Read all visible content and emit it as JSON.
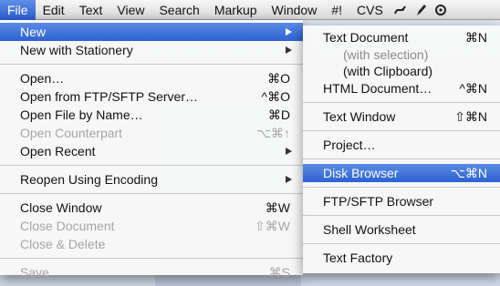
{
  "menubar": {
    "items": [
      "File",
      "Edit",
      "Text",
      "View",
      "Search",
      "Markup",
      "Window",
      "#!",
      "CVS"
    ],
    "icons": [
      "script-icon",
      "pencil-icon",
      "settings-icon"
    ]
  },
  "file_menu": {
    "new": "New",
    "new_stationery": "New with Stationery",
    "open": "Open…",
    "open_sc": "⌘O",
    "open_ftp": "Open from FTP/SFTP Server…",
    "open_ftp_sc": "^⌘O",
    "open_name": "Open File by Name…",
    "open_name_sc": "⌘D",
    "open_counterpart": "Open Counterpart",
    "open_counterpart_sc": "⌥⌘↑",
    "open_recent": "Open Recent",
    "reopen_encoding": "Reopen Using Encoding",
    "close_window": "Close Window",
    "close_window_sc": "⌘W",
    "close_document": "Close Document",
    "close_document_sc": "⇧⌘W",
    "close_delete": "Close & Delete",
    "save": "Save",
    "save_sc": "⌘S"
  },
  "new_submenu": {
    "text_document": "Text Document",
    "text_document_sc": "⌘N",
    "with_selection": "(with selection)",
    "with_clipboard": "(with Clipboard)",
    "html_document": "HTML Document…",
    "html_document_sc": "^⌘N",
    "text_window": "Text Window",
    "text_window_sc": "⇧⌘N",
    "project": "Project…",
    "disk_browser": "Disk Browser",
    "disk_browser_sc": "⌥⌘N",
    "ftp_browser": "FTP/SFTP Browser",
    "shell_worksheet": "Shell Worksheet",
    "text_factory": "Text Factory"
  },
  "colors": {
    "highlight": "#3a6fd8",
    "disabled_text": "#a6a6a6"
  }
}
